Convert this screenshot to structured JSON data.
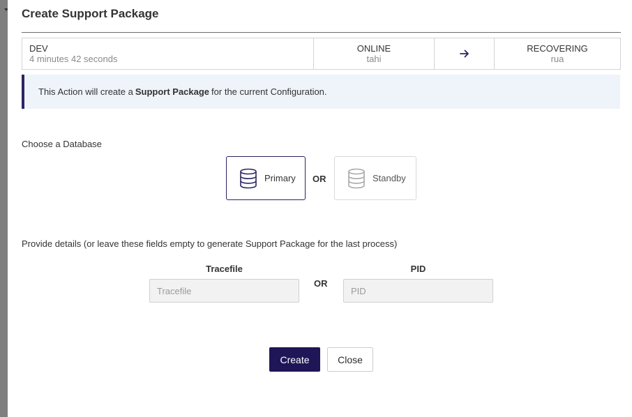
{
  "dialog": {
    "title": "Create Support Package"
  },
  "status_bar": {
    "environment": {
      "name": "DEV",
      "uptime": "4 minutes 42 seconds"
    },
    "primary": {
      "state": "ONLINE",
      "name": "tahi"
    },
    "arrow_icon": "arrow-right-icon",
    "standby": {
      "state": "RECOVERING",
      "name": "rua"
    }
  },
  "info": {
    "prefix": "This Action will create a",
    "highlight": "Support Package",
    "suffix": "for the current Configuration.",
    "accent_color": "#2b2460",
    "background_color": "#eef4fa"
  },
  "database": {
    "label": "Choose a Database",
    "or_label": "OR",
    "options": [
      {
        "label": "Primary",
        "icon": "database-icon",
        "selected": true
      },
      {
        "label": "Standby",
        "icon": "database-icon",
        "selected": false
      }
    ]
  },
  "details": {
    "label": "Provide details (or leave these fields empty to generate Support Package for the last process)",
    "or_label": "OR",
    "tracefile": {
      "label": "Tracefile",
      "placeholder": "Tracefile",
      "value": ""
    },
    "pid": {
      "label": "PID",
      "placeholder": "PID",
      "value": ""
    }
  },
  "actions": {
    "create_label": "Create",
    "close_label": "Close",
    "primary_color": "#1f1657"
  }
}
